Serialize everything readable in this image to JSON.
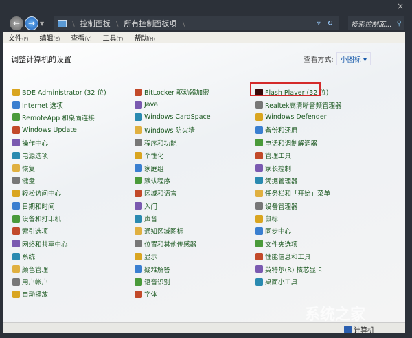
{
  "window": {
    "close": "×"
  },
  "address": {
    "crumbs": [
      "控制面板",
      "所有控制面板项"
    ],
    "search_placeholder": "搜索控制面..."
  },
  "menu": [
    {
      "label": "文件",
      "key": "(F)"
    },
    {
      "label": "编辑",
      "key": "(E)"
    },
    {
      "label": "查看",
      "key": "(V)"
    },
    {
      "label": "工具",
      "key": "(T)"
    },
    {
      "label": "帮助",
      "key": "(H)"
    }
  ],
  "heading": "调整计算机的设置",
  "view": {
    "label": "查看方式:",
    "value": "小图标"
  },
  "columns": [
    [
      "BDE Administrator (32 位)",
      "Internet 选项",
      "RemoteApp 和桌面连接",
      "Windows Update",
      "操作中心",
      "电源选项",
      "恢复",
      "键盘",
      "轻松访问中心",
      "日期和时间",
      "设备和打印机",
      "索引选项",
      "网络和共享中心",
      "系统",
      "颜色管理",
      "用户帐户",
      "自动播放"
    ],
    [
      "BitLocker 驱动器加密",
      "Java",
      "Windows CardSpace",
      "Windows 防火墙",
      "程序和功能",
      "个性化",
      "家庭组",
      "默认程序",
      "区域和语言",
      "入门",
      "声音",
      "通知区域图标",
      "位置和其他传感器",
      "显示",
      "疑难解答",
      "语音识别",
      "字体"
    ],
    [
      "Flash Player (32 位)",
      "Realtek高清晰音频管理器",
      "Windows Defender",
      "备份和还原",
      "电话和调制解调器",
      "管理工具",
      "家长控制",
      "凭据管理器",
      "任务栏和「开始」菜单",
      "设备管理器",
      "鼠标",
      "同步中心",
      "文件夹选项",
      "性能信息和工具",
      "英特尔(R) 核芯显卡",
      "桌面小工具"
    ]
  ],
  "status": {
    "item": "计算机"
  },
  "watermark": "系统之家",
  "colors": {
    "link": "#1d5a22",
    "highlight": "#d42a2a",
    "frame": "#2c3139"
  }
}
